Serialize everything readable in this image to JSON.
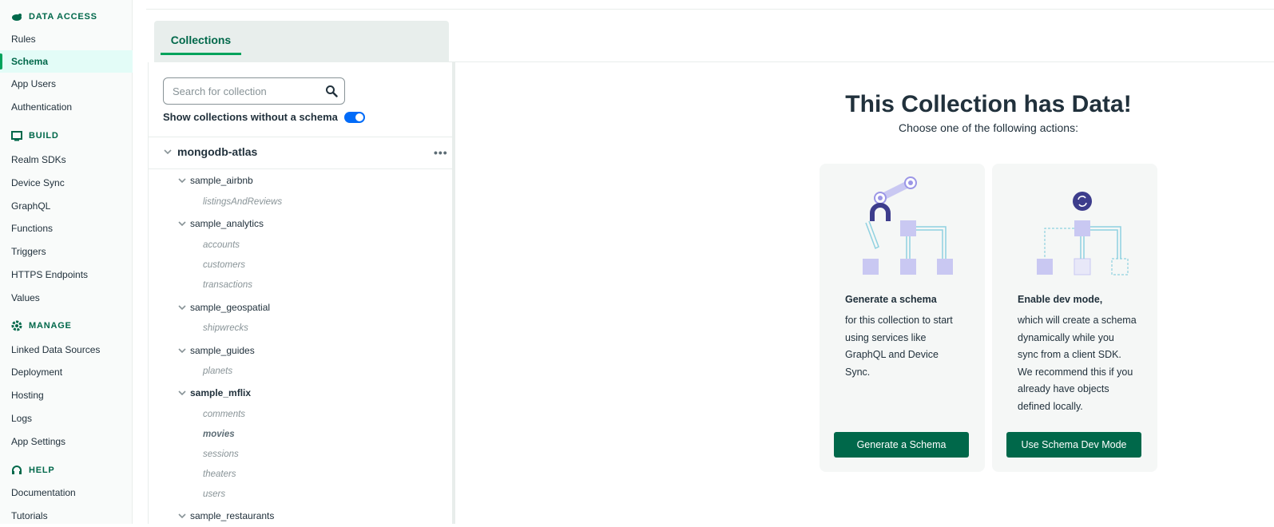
{
  "sidebar": {
    "sections": [
      {
        "title": "DATA ACCESS",
        "icon": "leaf-icon"
      },
      {
        "title": "BUILD",
        "icon": "build-icon"
      },
      {
        "title": "MANAGE",
        "icon": "gear-icon"
      },
      {
        "title": "HELP",
        "icon": "headset-icon"
      }
    ],
    "items": [
      "Rules",
      "Schema",
      "App Users",
      "Authentication",
      "Realm SDKs",
      "Device Sync",
      "GraphQL",
      "Functions",
      "Triggers",
      "HTTPS Endpoints",
      "Values",
      "Linked Data Sources",
      "Deployment",
      "Hosting",
      "Logs",
      "App Settings",
      "Documentation",
      "Tutorials"
    ],
    "active": "Schema"
  },
  "tabs": {
    "collections": "Collections"
  },
  "search": {
    "placeholder": "Search for collection"
  },
  "toggle": {
    "label": "Show collections without a schema",
    "on": true
  },
  "tree": {
    "db": "mongodb-atlas",
    "groups": [
      {
        "name": "sample_airbnb",
        "collections": [
          "listingsAndReviews"
        ]
      },
      {
        "name": "sample_analytics",
        "collections": [
          "accounts",
          "customers",
          "transactions"
        ]
      },
      {
        "name": "sample_geospatial",
        "collections": [
          "shipwrecks"
        ]
      },
      {
        "name": "sample_guides",
        "collections": [
          "planets"
        ]
      },
      {
        "name": "sample_mflix",
        "collections": [
          "comments",
          "movies",
          "sessions",
          "theaters",
          "users"
        ]
      },
      {
        "name": "sample_restaurants",
        "collections": []
      }
    ],
    "selected": "movies"
  },
  "main": {
    "title": "This Collection has Data!",
    "subtitle": "Choose one of the following actions:",
    "cards": [
      {
        "title": "Generate a schema",
        "text": "for this collection to start using services like GraphQL and Device Sync.",
        "button": "Generate a Schema"
      },
      {
        "title": "Enable dev mode,",
        "text": "which will create a schema dynamically while you sync from a client SDK. We recommend this if you already have objects defined locally.",
        "button": "Use Schema Dev Mode"
      }
    ]
  },
  "colors": {
    "brand": "#00684a",
    "accent": "#00a35c",
    "toggle": "#016bf8",
    "illustration": "#c9c8f2"
  }
}
